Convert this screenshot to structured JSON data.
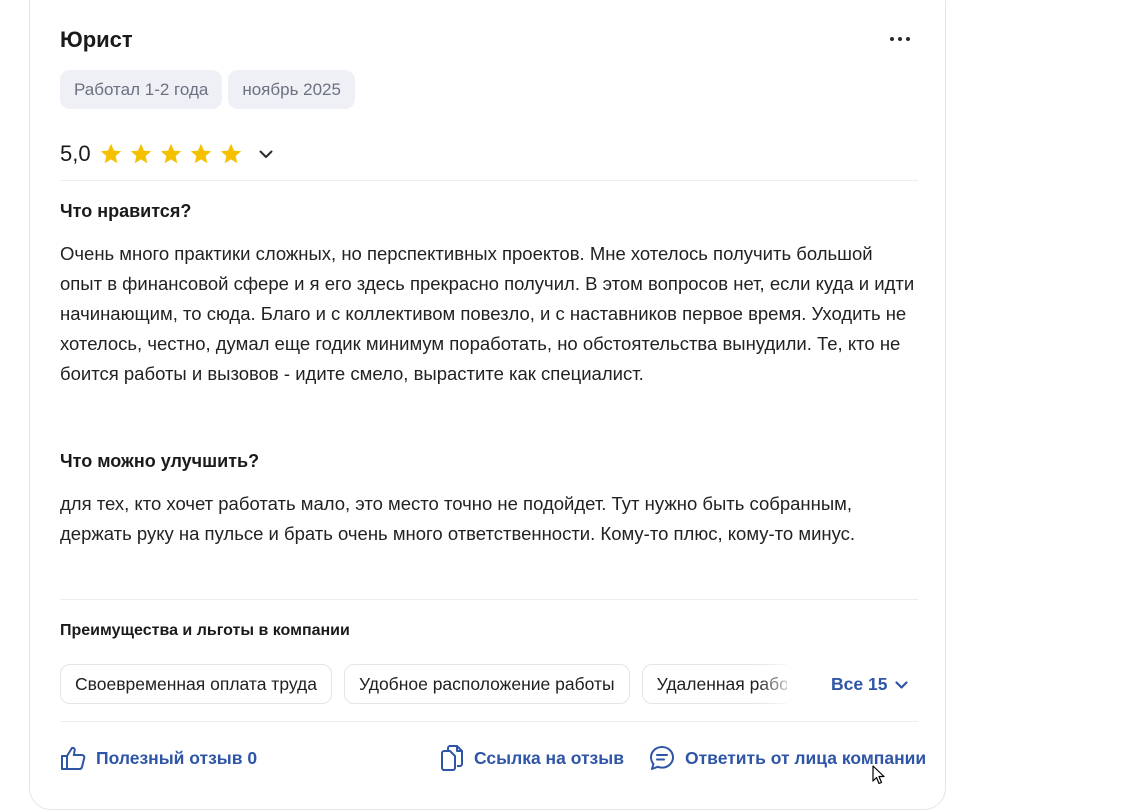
{
  "review": {
    "title": "Юрист",
    "tags": [
      "Работал 1-2 года",
      "ноябрь 2025"
    ],
    "rating": {
      "value_label": "5,0",
      "stars": 5,
      "max_stars": 5
    },
    "likes": {
      "heading": "Что нравится?",
      "text": "Очень много практики сложных, но перспективных проектов. Мне хотелось получить большой опыт в финансовой сфере и я его здесь прекрасно получил. В этом вопросов нет, если куда и идти начинающим, то сюда. Благо и с коллективом повезло, и с наставников первое время. Уходить не хотелось, честно, думал еще годик минимум поработать, но обстоятельства вынудили. Те, кто не боится работы и вызовов - идите смело, вырастите как специалист."
    },
    "improve": {
      "heading": "Что можно улучшить?",
      "text": "для тех, кто хочет работать мало, это место точно не подойдет. Тут нужно быть собранным, держать руку на пульсе и брать очень много ответственности. Кому-то плюс, кому-то минус."
    },
    "benefits": {
      "heading": "Преимущества и льготы в компании",
      "items": [
        "Своевременная оплата труда",
        "Удобное расположение работы",
        "Удаленная работа"
      ],
      "all_label": "Все 15"
    },
    "actions": {
      "useful_label": "Полезный отзыв 0",
      "link_label": "Ссылка на отзыв",
      "reply_label": "Ответить от лица компании"
    }
  },
  "colors": {
    "accent": "#2e55a6",
    "star": "#f5c000",
    "tag_bg": "#eef0f5",
    "tag_text": "#6b7180"
  },
  "icons": {
    "menu": "more-dots-icon",
    "star": "star-icon",
    "expand": "chevron-down-icon",
    "useful": "thumbs-up-icon",
    "link": "copy-link-icon",
    "reply": "chat-bubble-icon"
  }
}
